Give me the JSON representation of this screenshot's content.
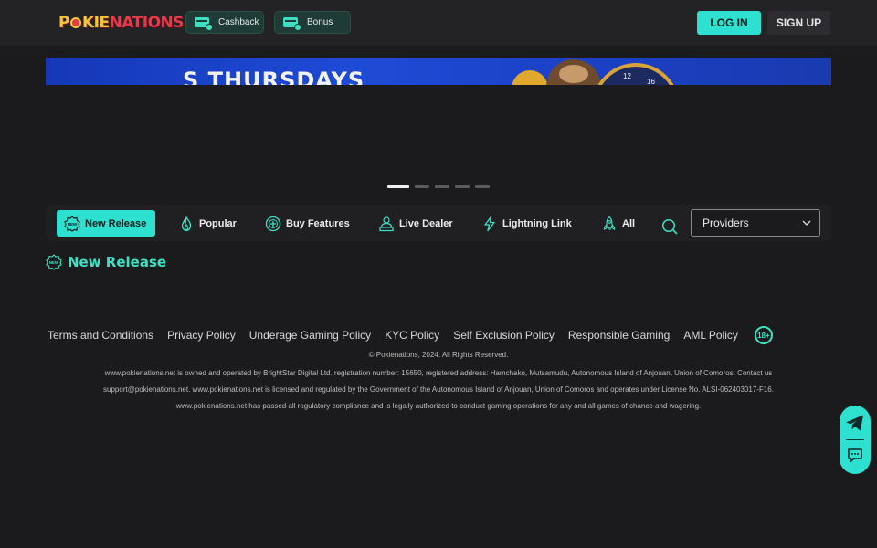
{
  "header": {
    "logo_part1": "P",
    "logo_part2": "KIE",
    "logo_part3": "NATIONS",
    "pills": [
      {
        "label": "Cashback",
        "icon": "wallet-icon"
      },
      {
        "label": "Bonus",
        "icon": "wallet-icon"
      }
    ],
    "login_label": "LOG IN",
    "signup_label": "SIGN UP"
  },
  "banner": {
    "visible_text": "S THURSDAYS",
    "wheel_numbers": [
      "12",
      "16"
    ]
  },
  "carousel": {
    "slide_count": 5,
    "active_index": 0
  },
  "tabs": [
    {
      "label": "New Release",
      "icon": "new-badge-icon",
      "active": true
    },
    {
      "label": "Popular",
      "icon": "flame-icon",
      "active": false
    },
    {
      "label": "Buy Features",
      "icon": "plus-circle-icon",
      "active": false
    },
    {
      "label": "Live Dealer",
      "icon": "dealer-icon",
      "active": false
    },
    {
      "label": "Lightning Link",
      "icon": "lightning-icon",
      "active": false
    },
    {
      "label": "All",
      "icon": "rocket-icon",
      "active": false
    }
  ],
  "providers_select": {
    "selected": "Providers"
  },
  "section": {
    "title": "New Release",
    "icon": "new-badge-icon"
  },
  "footer": {
    "links": [
      "Terms and Conditions",
      "Privacy Policy",
      "Underage Gaming Policy",
      "KYC Policy",
      "Self Exclusion Policy",
      "Responsible Gaming",
      "AML Policy"
    ],
    "age_badge": "18+",
    "copyright": "© Pokienations, 2024. All Rights Reserved.",
    "legal_line1": "www.pokienations.net is owned and operated by BrightStar Digital Ltd. registration number: 15650, registered address: Hamchako, Mutsamudu, Autonomous Island of Anjouan, Union of Comoros. Contact us",
    "legal_line2": "support@pokienations.net. www.pokienations.net is licensed and regulated by the Government of the Autonomous Island of Anjouan, Union of Comoros and operates under License No. ALSI-062403017-F16.",
    "legal_line3": "www.pokienations.net has passed all regulatory compliance and is legally authorized to conduct gaming operations for any and all games of chance and wagering."
  },
  "colors": {
    "accent": "#2ee0d0",
    "accent_text": "#3fe0c2",
    "background": "#1b1b1d",
    "header": "#232326",
    "logo_yellow": "#f4c63c",
    "logo_red": "#e8394a"
  },
  "float_widget": {
    "icons": [
      "telegram-icon",
      "chat-icon"
    ]
  }
}
